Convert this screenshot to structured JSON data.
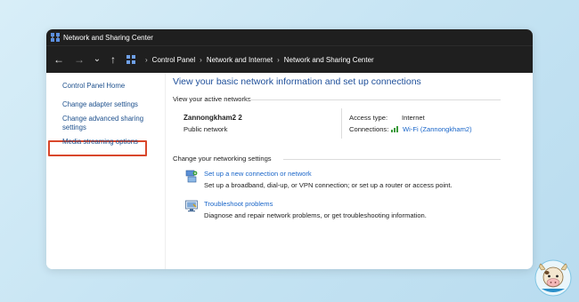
{
  "window": {
    "title": "Network and Sharing Center"
  },
  "nav": {
    "back": "←",
    "forward": "→",
    "dropdown": "⌄",
    "up": "↑"
  },
  "breadcrumb": [
    "Control Panel",
    "Network and Internet",
    "Network and Sharing Center"
  ],
  "breadcrumb_sep": "›",
  "sidebar": {
    "items": [
      {
        "label": "Control Panel Home"
      },
      {
        "label": "Change adapter settings",
        "highlighted": true
      },
      {
        "label": "Change advanced sharing settings",
        "lines": [
          "Change advanced sharing",
          "settings"
        ]
      },
      {
        "label": "Media streaming options"
      }
    ]
  },
  "main": {
    "title": "View your basic network information and set up connections",
    "active_networks_heading": "View your active networks",
    "network": {
      "name": "Zannongkham2 2",
      "category": "Public network",
      "access_type_label": "Access type:",
      "access_type_value": "Internet",
      "connections_label": "Connections:",
      "connection_value": "Wi-Fi (Zannongkham2)"
    },
    "change_heading": "Change your networking settings",
    "tasks": [
      {
        "icon": "new-connection-icon",
        "link": "Set up a new connection or network",
        "desc": "Set up a broadband, dial-up, or VPN connection; or set up a router or access point."
      },
      {
        "icon": "troubleshoot-icon",
        "link": "Troubleshoot problems",
        "desc": "Diagnose and repair network problems, or get troubleshooting information."
      }
    ]
  },
  "colors": {
    "titlebar": "#1f1f1f",
    "link": "#1a66c9",
    "title": "#1e4f9a",
    "highlight": "#d9472b",
    "background": "#c6e4f3"
  }
}
